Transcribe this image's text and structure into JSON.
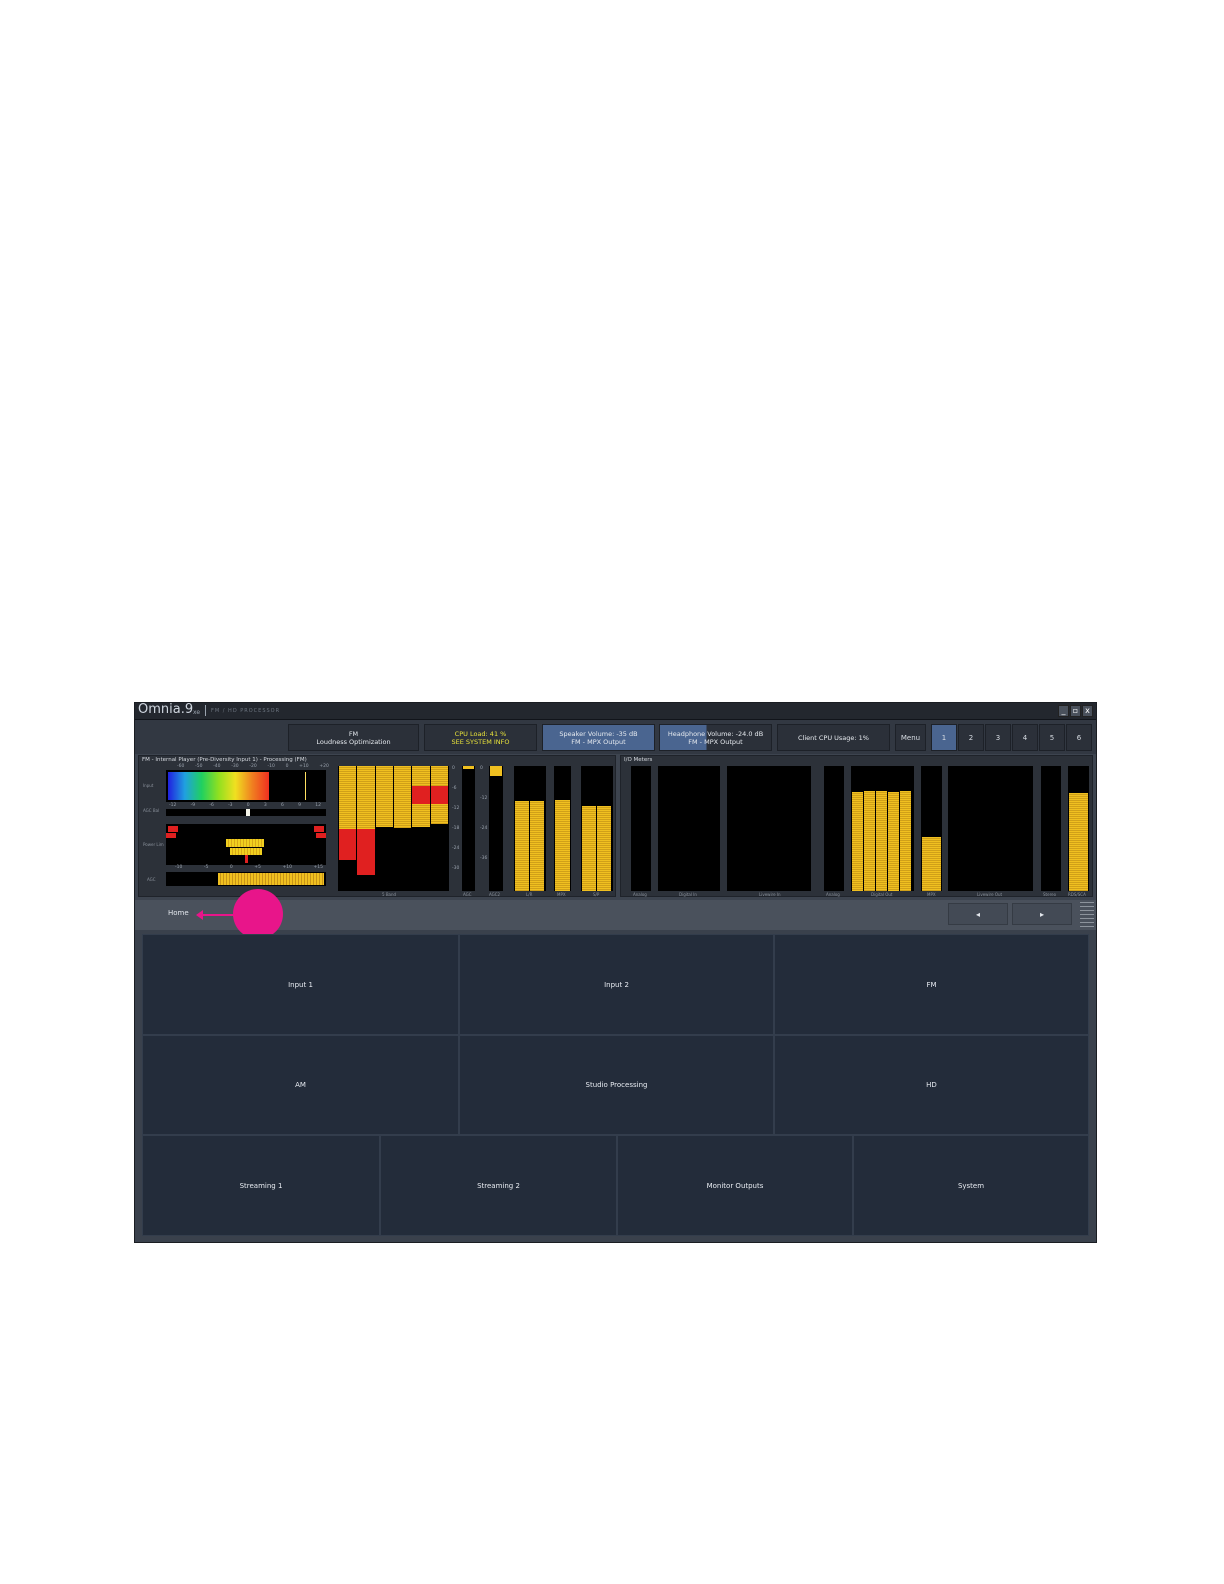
{
  "app": {
    "logo": "Omnia.9",
    "logo_sub": "xe",
    "logo_tag": "FM / HD PROCESSOR",
    "window_buttons": [
      "_",
      "▫",
      "x"
    ]
  },
  "status": {
    "mode_line1": "FM",
    "mode_line2": "Loudness Optimization",
    "cpu_line1": "CPU Load: 41 %",
    "cpu_line2": "SEE SYSTEM INFO",
    "speaker_line1": "Speaker Volume: -35 dB",
    "speaker_line2": "FM - MPX Output",
    "headphone_line1": "Headphone Volume: -24.0 dB",
    "headphone_line2": "FM - MPX Output",
    "client_cpu": "Client CPU Usage: 1%",
    "menu": "Menu",
    "tabs": [
      "1",
      "2",
      "3",
      "4",
      "5",
      "6"
    ]
  },
  "meters": {
    "left_title": "FM - Internal Player (Pre-Diversity Input 1) - Processing (FM)",
    "right_title": "I/O Meters",
    "row_labels": [
      "Input",
      "AGC Bal",
      "Power Lim",
      "AGC"
    ],
    "top_scale": [
      "-60",
      "-50",
      "-40",
      "-30",
      "-20",
      "-10",
      "0",
      "+10",
      "+20"
    ],
    "agc_scale": [
      "-10",
      "-5",
      "0",
      "+5",
      "+10",
      "+15"
    ],
    "left_meter_labels": [
      "5 Band",
      "AGC",
      "AGC2",
      "L/R",
      "MPX",
      "S/P"
    ],
    "right_meter_labels": [
      "Analog",
      "Digital In",
      "Livewire In",
      "Analog",
      "Digital Out",
      "MPX",
      "Livewire Out",
      "Stereo",
      "RDS/SCA"
    ]
  },
  "nav": {
    "home": "Home",
    "prev": "◂",
    "next": "▸"
  },
  "grid": {
    "row1": [
      "Input 1",
      "Input 2",
      "FM"
    ],
    "row2": [
      "AM",
      "Studio Processing",
      "HD"
    ],
    "row3": [
      "Streaming 1",
      "Streaming 2",
      "Monitor Outputs",
      "System"
    ]
  },
  "colors": {
    "meter_yellow": "#e8b52a",
    "meter_red": "#e02020",
    "annotation_pink": "#e8158a",
    "active_tab": "#4a6590"
  },
  "meter_levels": {
    "five_band_yellow": [
      0.87,
      0.88,
      0.89,
      0.9,
      0.88,
      0.85
    ],
    "five_band_red": [
      0.33,
      0.48,
      0.0,
      0.0,
      0.64,
      0.75
    ],
    "agc": 0.98,
    "agc2": 0.92,
    "lr": [
      0.72,
      0.72
    ],
    "mpx": 0.73,
    "sp": [
      0.68,
      0.68
    ],
    "digital_out": [
      0.79,
      0.8,
      0.8,
      0.79,
      0.8
    ],
    "mpx_out": 0.43,
    "rds": 0.78
  }
}
